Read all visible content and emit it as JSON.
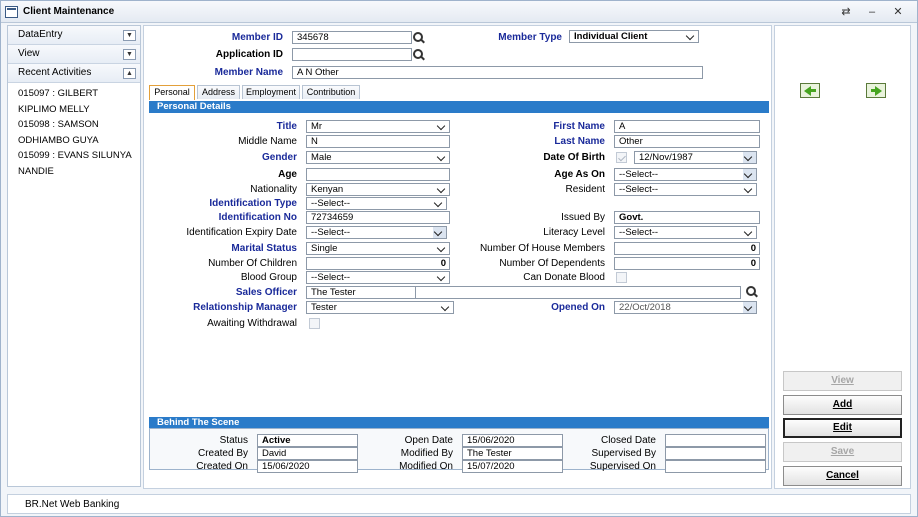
{
  "window": {
    "title": "Client Maintenance"
  },
  "sidebar": {
    "data_entry": "DataEntry",
    "view": "View",
    "recent": "Recent Activities",
    "items": [
      "015097 : GILBERT",
      "KIPLIMO MELLY",
      "015098 : SAMSON",
      "ODHIAMBO GUYA",
      "015099 : EVANS SILUNYA",
      "NANDIE"
    ]
  },
  "header": {
    "member_id_label": "Member ID",
    "member_id": "345678",
    "application_id_label": "Application ID",
    "application_id": "",
    "member_type_label": "Member Type",
    "member_type": "Individual Client",
    "member_name_label": "Member Name",
    "member_name": "A N Other"
  },
  "tabs": [
    "Personal",
    "Address",
    "Employment",
    "Contribution"
  ],
  "personal": {
    "section_title": "Personal Details",
    "title_label": "Title",
    "title": "Mr",
    "middle_name_label": "Middle Name",
    "middle_name": "N",
    "gender_label": "Gender",
    "gender": "Male",
    "age_label": "Age",
    "age": "",
    "nationality_label": "Nationality",
    "nationality": "Kenyan",
    "id_type_label": "Identification Type",
    "id_type": "--Select--",
    "id_no_label": "Identification No",
    "id_no": "72734659",
    "id_expiry_label": "Identification Expiry Date",
    "id_expiry": "--Select--",
    "marital_label": "Marital Status",
    "marital": "Single",
    "children_label": "Number Of Children",
    "children": "0",
    "blood_label": "Blood Group",
    "blood": "--Select--",
    "sales_officer_label": "Sales Officer",
    "sales_officer": "The Tester",
    "rel_manager_label": "Relationship Manager",
    "rel_manager": "Tester",
    "awaiting_label": "Awaiting Withdrawal",
    "first_name_label": "First Name",
    "first_name": "A",
    "last_name_label": "Last Name",
    "last_name": "Other",
    "dob_label": "Date Of Birth",
    "dob": "12/Nov/1987",
    "age_as_on_label": "Age As On",
    "age_as_on": "--Select--",
    "resident_label": "Resident",
    "resident": "--Select--",
    "issued_by_label": "Issued By",
    "issued_by": "Govt.",
    "literacy_label": "Literacy Level",
    "literacy": "--Select--",
    "house_members_label": "Number Of House Members",
    "house_members": "0",
    "dependents_label": "Number Of Dependents",
    "dependents": "0",
    "donate_blood_label": "Can Donate Blood",
    "opened_on_label": "Opened On",
    "opened_on": "22/Oct/2018"
  },
  "behind": {
    "section_title": "Behind The Scene",
    "status_label": "Status",
    "status": "Active",
    "created_by_label": "Created By",
    "created_by": "David",
    "created_on_label": "Created On",
    "created_on": "15/06/2020",
    "open_date_label": "Open Date",
    "open_date": "15/06/2020",
    "modified_by_label": "Modified By",
    "modified_by": "The Tester",
    "modified_on_label": "Modified On",
    "modified_on": "15/07/2020",
    "closed_date_label": "Closed Date",
    "closed_date": "",
    "supervised_by_label": "Supervised By",
    "supervised_by": "",
    "supervised_on_label": "Supervised On",
    "supervised_on": ""
  },
  "actions": {
    "view": "View",
    "add": "Add",
    "edit": "Edit",
    "save": "Save",
    "cancel": "Cancel"
  },
  "status_bar": {
    "text": "BR.Net Web Banking"
  }
}
